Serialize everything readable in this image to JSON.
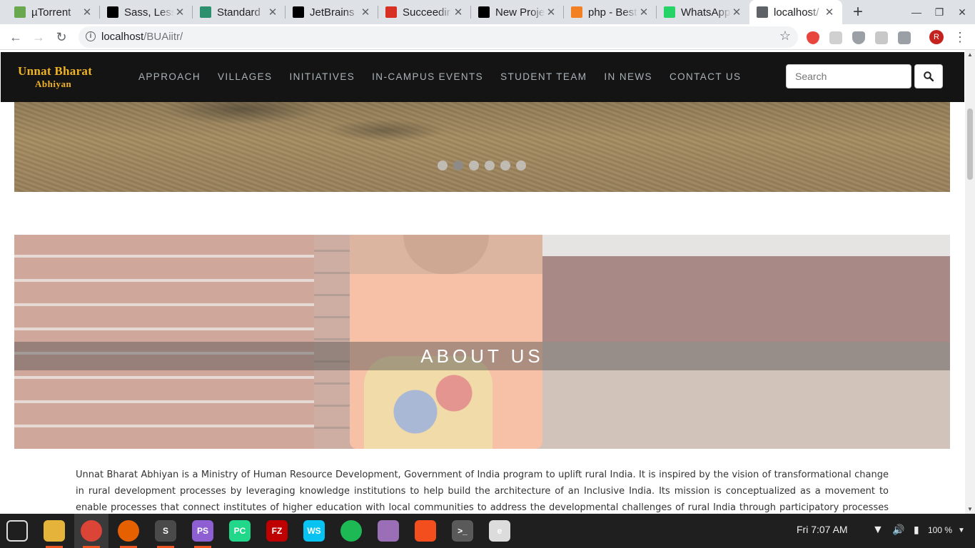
{
  "browser": {
    "tabs": [
      {
        "title": "µTorrent",
        "favicon": "utorrent-icon",
        "color": "#6aa84f"
      },
      {
        "title": "Sass, Less",
        "favicon": "jetbrains-icon",
        "color": "#000000"
      },
      {
        "title": "Standard",
        "favicon": "stack-icon",
        "color": "#2c8f6e"
      },
      {
        "title": "JetBrains",
        "favicon": "jetbrains-icon",
        "color": "#000000"
      },
      {
        "title": "Succeedir",
        "favicon": "gmail-icon",
        "color": "#d93025"
      },
      {
        "title": "New Proje",
        "favicon": "jetbrains-icon",
        "color": "#000000"
      },
      {
        "title": "php - Best",
        "favicon": "stackoverflow-icon",
        "color": "#f48024"
      },
      {
        "title": "WhatsApp",
        "favicon": "whatsapp-icon",
        "color": "#25d366"
      },
      {
        "title": "localhost/",
        "favicon": "page-icon",
        "color": "#5f6368",
        "active": true
      }
    ],
    "address": {
      "host": "localhost",
      "path": "/BUAiitr/"
    },
    "profile_initial": "R",
    "new_tab_label": "+"
  },
  "site": {
    "logo": {
      "line1": "Unnat Bharat",
      "line2": "Abhiyan"
    },
    "menu": [
      "APPROACH",
      "VILLAGES",
      "INITIATIVES",
      "IN-CAMPUS EVENTS",
      "STUDENT TEAM",
      "IN NEWS",
      "CONTACT US"
    ],
    "search": {
      "placeholder": "Search"
    },
    "carousel": {
      "slide_count": 6,
      "active_index": 1
    },
    "about_heading": "ABOUT US",
    "intro_text": "Unnat Bharat Abhiyan is a Ministry of Human Resource Development, Government of India program to uplift rural India. It is inspired by the vision of transformational change in rural development processes by leveraging knowledge institutions to help build the architecture of an Inclusive India. Its mission is conceptualized as a movement to enable processes that connect institutes of higher education with local communities to address the developmental challenges of rural India through participatory processes and appropriate technologies for"
  },
  "taskbar": {
    "apps": [
      {
        "name": "apps-grid-icon",
        "label": "",
        "color": "#1f1f1f"
      },
      {
        "name": "files-icon",
        "label": "",
        "color": "#e6b33a"
      },
      {
        "name": "chrome-icon",
        "label": "",
        "color": "#db4437",
        "active": true
      },
      {
        "name": "firefox-icon",
        "label": "",
        "color": "#e66000"
      },
      {
        "name": "sublime-icon",
        "label": "S",
        "color": "#4a4a4a"
      },
      {
        "name": "phpstorm-icon",
        "label": "PS",
        "color": "#8d5fd3"
      },
      {
        "name": "pycharm-icon",
        "label": "PC",
        "color": "#21d789"
      },
      {
        "name": "filezilla-icon",
        "label": "FZ",
        "color": "#bf0000"
      },
      {
        "name": "webstorm-icon",
        "label": "WS",
        "color": "#07c3f2"
      },
      {
        "name": "spotify-icon",
        "label": "",
        "color": "#1db954"
      },
      {
        "name": "text-editor-icon",
        "label": "",
        "color": "#9b6fb8"
      },
      {
        "name": "figma-icon",
        "label": "",
        "color": "#f24e1e"
      },
      {
        "name": "terminal-icon",
        "label": ">_",
        "color": "#5a5a5a"
      },
      {
        "name": "emblem-icon",
        "label": "e",
        "color": "#dcdcdc"
      }
    ],
    "clock": "Fri  7:07 AM",
    "battery": "100 %"
  }
}
